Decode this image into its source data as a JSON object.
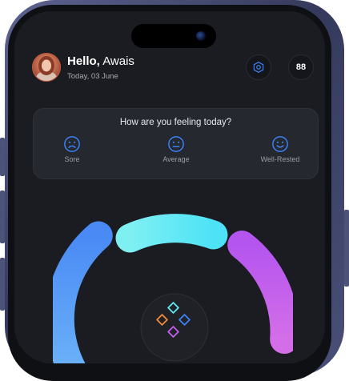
{
  "header": {
    "greeting_bold": "Hello,",
    "greeting_name": "Awais",
    "date": "Today, 03 June",
    "score": "88"
  },
  "mood_card": {
    "question": "How are you feeling today?",
    "options": [
      {
        "label": "Sore",
        "icon": "sad-face-icon"
      },
      {
        "label": "Average",
        "icon": "neutral-face-icon"
      },
      {
        "label": "Well-Rested",
        "icon": "happy-face-icon"
      }
    ]
  },
  "colors": {
    "accent_blue": "#3b82f6",
    "segment_blue": "#4f8ef5",
    "segment_cyan": "#5de8f5",
    "segment_purple": "#c35ff0",
    "background": "#1b1c21"
  }
}
